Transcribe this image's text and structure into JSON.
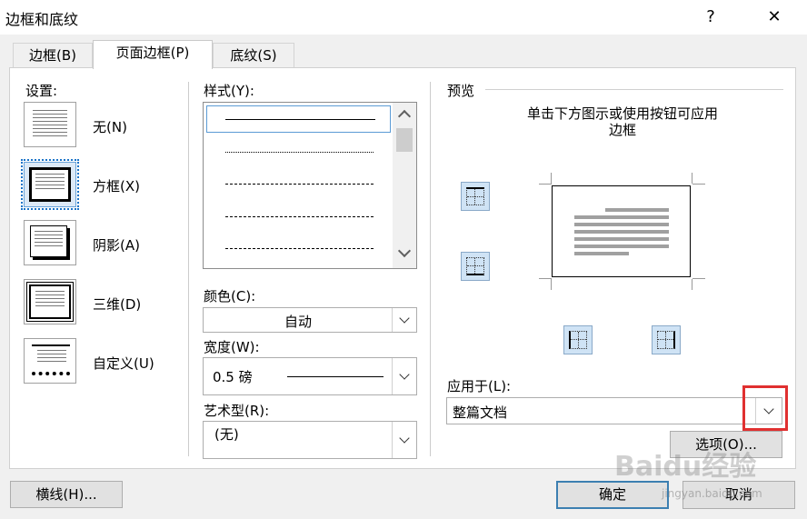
{
  "dialog": {
    "title": "边框和底纹",
    "help": "?",
    "close": "✕"
  },
  "tabs": [
    {
      "label": "边框(B)"
    },
    {
      "label": "页面边框(P)"
    },
    {
      "label": "底纹(S)"
    }
  ],
  "settings": {
    "heading": "设置:",
    "items": [
      {
        "label": "无(N)"
      },
      {
        "label": "方框(X)"
      },
      {
        "label": "阴影(A)"
      },
      {
        "label": "三维(D)"
      },
      {
        "label": "自定义(U)"
      }
    ]
  },
  "style": {
    "heading": "样式(Y):"
  },
  "color": {
    "heading": "颜色(C):",
    "value": "自动"
  },
  "width": {
    "heading": "宽度(W):",
    "value": "0.5 磅"
  },
  "art": {
    "heading": "艺术型(R):",
    "value": "(无)"
  },
  "preview": {
    "heading": "预览",
    "hint_line1": "单击下方图示或使用按钮可应用",
    "hint_line2": "边框"
  },
  "apply_to": {
    "heading": "应用于(L):",
    "value": "整篇文档"
  },
  "buttons": {
    "options": "选项(O)...",
    "horizontal_line": "横线(H)...",
    "ok": "确定",
    "cancel": "取消"
  },
  "watermark": {
    "text": "Baidu经验",
    "url": "jingyan.baidu.com"
  },
  "colors": {
    "highlight": "#e03030",
    "accent": "#3c7fb1"
  }
}
